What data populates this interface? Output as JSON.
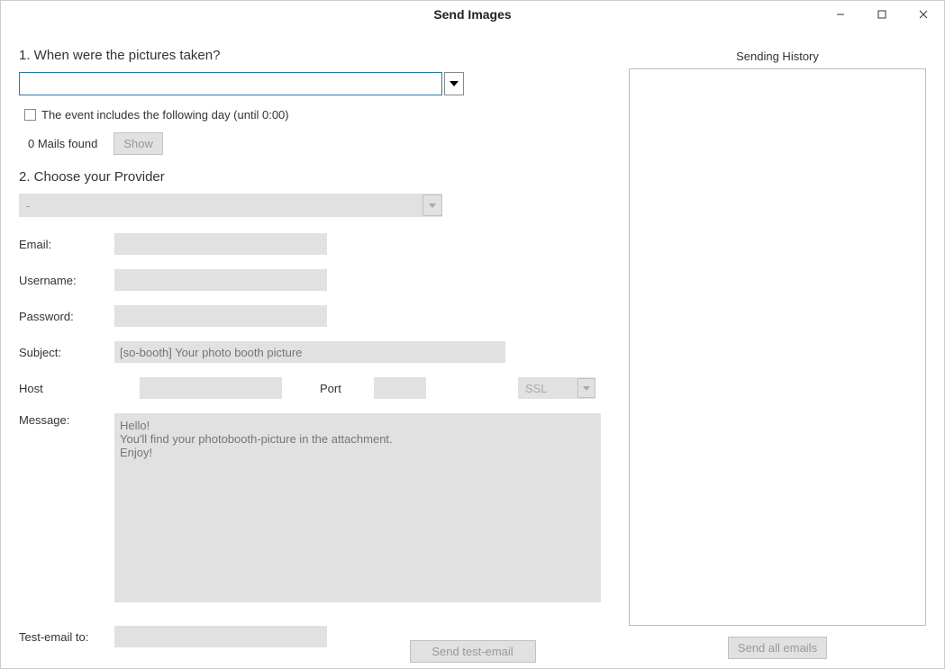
{
  "window": {
    "title": "Send Images"
  },
  "section1": {
    "heading": "1. When were the pictures taken?",
    "date_value": "",
    "include_next_day_label": "The event includes the following day (until 0:00)",
    "mails_found_text": "0 Mails found",
    "show_button": "Show"
  },
  "section2": {
    "heading": "2. Choose your Provider",
    "provider_value": "-",
    "email_label": "Email:",
    "email_value": "",
    "username_label": "Username:",
    "username_value": "",
    "password_label": "Password:",
    "password_value": "",
    "subject_label": "Subject:",
    "subject_placeholder": "[so-booth] Your photo booth picture",
    "host_label": "Host",
    "host_value": "",
    "port_label": "Port",
    "port_value": "",
    "security_value": "SSL",
    "message_label": "Message:",
    "message_placeholder": "Hello!\nYou'll find your photobooth-picture in the attachment.\nEnjoy!"
  },
  "test": {
    "label": "Test-email to:",
    "value": "",
    "send_button": "Send test-email"
  },
  "history": {
    "heading": "Sending History",
    "send_all_button": "Send all emails"
  }
}
